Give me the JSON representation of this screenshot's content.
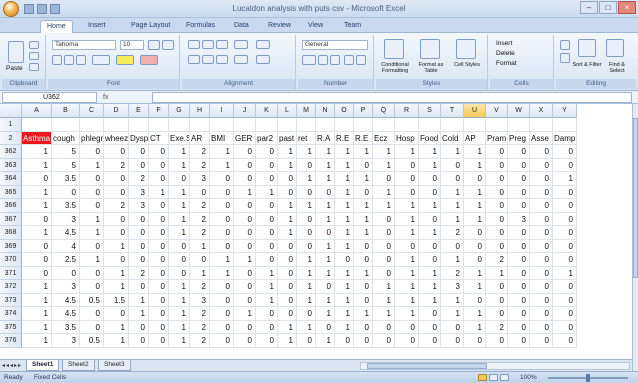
{
  "app": {
    "title": "Lucaldon analysis with puts csv - Microsoft Excel",
    "window_controls": [
      "–",
      "□",
      "×"
    ]
  },
  "ribbon_tabs": [
    "Home",
    "Insert",
    "Page Layout",
    "Formulas",
    "Data",
    "Review",
    "View",
    "Team"
  ],
  "ribbon": {
    "clipboard": {
      "label": "Clipboard",
      "paste": "Paste"
    },
    "font": {
      "label": "Font",
      "family": "Tahoma",
      "size": "10"
    },
    "alignment": {
      "label": "Alignment"
    },
    "number": {
      "label": "Number",
      "format": "General"
    },
    "styles": {
      "label": "Styles",
      "buttons": [
        "Conditional Formatting",
        "Format as Table",
        "Cell Styles"
      ]
    },
    "cells": {
      "label": "Cells",
      "buttons": [
        "Insert",
        "Delete",
        "Format"
      ]
    },
    "editing": {
      "label": "Editing",
      "buttons": [
        "Sort & Filter",
        "Find & Select"
      ]
    }
  },
  "formula_bar": {
    "name_box": "U362",
    "fx": "fx",
    "value": ""
  },
  "sheet": {
    "columns": [
      "A",
      "B",
      "C",
      "D",
      "E",
      "F",
      "G",
      "H",
      "I",
      "J",
      "K",
      "L",
      "M",
      "N",
      "O",
      "P",
      "Q",
      "R",
      "S",
      "T",
      "U",
      "V",
      "W",
      "X",
      "Y"
    ],
    "selected_column": "U",
    "header_row_numbers": [
      "1",
      "2"
    ],
    "headers": [
      "Asthma",
      "cough",
      "phlegm",
      "wheeze",
      "Dysp",
      "CT",
      "",
      "Exe.S",
      "AR",
      "",
      "BMI",
      "GER",
      "",
      "par2",
      "",
      "past",
      "ret",
      "R.A",
      "R.E",
      "R.E",
      "Ecz",
      "Hosp",
      "Food",
      "Cold",
      "AP",
      "",
      "Pram",
      "Preg",
      "Asse",
      "Damp"
    ],
    "header_cells": [
      {
        "col": "A",
        "text": "Asthma",
        "highlight": "#e8181c"
      },
      {
        "col": "B",
        "text": "cough"
      },
      {
        "col": "C",
        "text": "phlegm"
      },
      {
        "col": "D",
        "text": "wheeze"
      },
      {
        "col": "E",
        "text": "Dysp"
      },
      {
        "col": "F",
        "text": "CT"
      },
      {
        "col": "G",
        "text": "Exe.S"
      },
      {
        "col": "H",
        "text": "AR"
      },
      {
        "col": "I",
        "text": "BMI"
      },
      {
        "col": "J",
        "text": "GER"
      },
      {
        "col": "K",
        "text": "par2"
      },
      {
        "col": "L",
        "text": "past"
      },
      {
        "col": "M",
        "text": "ret"
      },
      {
        "col": "N",
        "text": "R.A"
      },
      {
        "col": "O",
        "text": "R.E"
      },
      {
        "col": "P",
        "text": "R.E"
      },
      {
        "col": "Q",
        "text": "Ecz"
      },
      {
        "col": "R",
        "text": "Hosp"
      },
      {
        "col": "S",
        "text": "Food"
      },
      {
        "col": "T",
        "text": "Cold"
      },
      {
        "col": "U",
        "text": "AP"
      },
      {
        "col": "V",
        "text": "Pram"
      },
      {
        "col": "W",
        "text": "Preg"
      },
      {
        "col": "X",
        "text": "Asse"
      },
      {
        "col": "Y",
        "text": "Damp"
      }
    ],
    "rows": [
      {
        "n": "362",
        "v": [
          "1",
          "5",
          "0",
          "0",
          "0",
          "0",
          "1",
          "2",
          "1",
          "0",
          "0",
          "1",
          "1",
          "1",
          "1",
          "1",
          "1",
          "1",
          "1",
          "1",
          "1",
          "0",
          "0",
          "0",
          "0"
        ]
      },
      {
        "n": "363",
        "v": [
          "1",
          "5",
          "1",
          "2",
          "0",
          "0",
          "1",
          "2",
          "1",
          "0",
          "0",
          "1",
          "0",
          "1",
          "1",
          "0",
          "1",
          "0",
          "1",
          "0",
          "1",
          "0",
          "0",
          "0",
          "0"
        ]
      },
      {
        "n": "364",
        "v": [
          "0",
          "3.5",
          "0",
          "0",
          "2",
          "0",
          "0",
          "3",
          "0",
          "0",
          "0",
          "0",
          "1",
          "1",
          "1",
          "1",
          "0",
          "0",
          "0",
          "0",
          "0",
          "0",
          "0",
          "0",
          "1"
        ]
      },
      {
        "n": "365",
        "v": [
          "1",
          "0",
          "0",
          "0",
          "3",
          "1",
          "1",
          "0",
          "0",
          "1",
          "1",
          "0",
          "0",
          "0",
          "1",
          "0",
          "1",
          "0",
          "0",
          "1",
          "1",
          "0",
          "0",
          "0",
          "0"
        ]
      },
      {
        "n": "366",
        "v": [
          "1",
          "3.5",
          "0",
          "2",
          "3",
          "0",
          "1",
          "2",
          "0",
          "0",
          "0",
          "1",
          "1",
          "1",
          "1",
          "1",
          "1",
          "1",
          "1",
          "1",
          "1",
          "0",
          "0",
          "0",
          "0"
        ]
      },
      {
        "n": "367",
        "v": [
          "0",
          "3",
          "1",
          "0",
          "0",
          "0",
          "1",
          "2",
          "0",
          "0",
          "0",
          "1",
          "0",
          "1",
          "1",
          "1",
          "0",
          "1",
          "0",
          "1",
          "1",
          "0",
          "3",
          "0",
          "0"
        ]
      },
      {
        "n": "368",
        "v": [
          "1",
          "4.5",
          "1",
          "0",
          "0",
          "0",
          "1",
          "2",
          "0",
          "0",
          "0",
          "1",
          "0",
          "0",
          "1",
          "1",
          "0",
          "1",
          "1",
          "2",
          "0",
          "0",
          "0",
          "0",
          "0"
        ]
      },
      {
        "n": "369",
        "v": [
          "0",
          "4",
          "0",
          "1",
          "0",
          "0",
          "0",
          "1",
          "0",
          "0",
          "0",
          "0",
          "0",
          "1",
          "1",
          "0",
          "0",
          "0",
          "0",
          "0",
          "0",
          "0",
          "0",
          "0",
          "0"
        ]
      },
      {
        "n": "370",
        "v": [
          "0",
          "2.5",
          "1",
          "0",
          "0",
          "0",
          "0",
          "0",
          "1",
          "1",
          "0",
          "0",
          "1",
          "1",
          "0",
          "0",
          "0",
          "1",
          "0",
          "1",
          "0",
          "2",
          "0",
          "0",
          "0"
        ]
      },
      {
        "n": "371",
        "v": [
          "0",
          "0",
          "0",
          "1",
          "2",
          "0",
          "0",
          "1",
          "1",
          "0",
          "1",
          "0",
          "1",
          "1",
          "1",
          "1",
          "0",
          "1",
          "1",
          "2",
          "1",
          "1",
          "0",
          "0",
          "1"
        ]
      },
      {
        "n": "372",
        "v": [
          "1",
          "3",
          "0",
          "1",
          "0",
          "0",
          "1",
          "2",
          "0",
          "0",
          "1",
          "0",
          "1",
          "0",
          "1",
          "0",
          "1",
          "1",
          "1",
          "3",
          "1",
          "0",
          "0",
          "0",
          "0"
        ]
      },
      {
        "n": "373",
        "v": [
          "1",
          "4.5",
          "0.5",
          "1.5",
          "1",
          "0",
          "1",
          "3",
          "0",
          "0",
          "1",
          "0",
          "1",
          "1",
          "1",
          "0",
          "1",
          "1",
          "1",
          "1",
          "0",
          "0",
          "0",
          "0",
          "0"
        ]
      },
      {
        "n": "374",
        "v": [
          "1",
          "4.5",
          "0",
          "0",
          "1",
          "0",
          "1",
          "2",
          "0",
          "1",
          "0",
          "0",
          "0",
          "1",
          "1",
          "1",
          "1",
          "1",
          "0",
          "1",
          "1",
          "0",
          "0",
          "0",
          "0"
        ]
      },
      {
        "n": "375",
        "v": [
          "1",
          "3.5",
          "0",
          "1",
          "0",
          "0",
          "1",
          "2",
          "0",
          "0",
          "0",
          "1",
          "1",
          "0",
          "1",
          "0",
          "0",
          "0",
          "0",
          "0",
          "1",
          "2",
          "0",
          "0",
          "0"
        ]
      },
      {
        "n": "376",
        "v": [
          "1",
          "3",
          "0.5",
          "1",
          "0",
          "0",
          "1",
          "2",
          "0",
          "0",
          "0",
          "1",
          "0",
          "1",
          "0",
          "0",
          "0",
          "0",
          "0",
          "0",
          "0",
          "0",
          "0",
          "0",
          "0"
        ]
      }
    ]
  },
  "sheet_tabs": [
    "Sheet1",
    "Sheet2",
    "Sheet3"
  ],
  "active_sheet": "Sheet1",
  "status": {
    "ready": "Ready",
    "extra": "Fixed Cells",
    "zoom": "100%"
  }
}
